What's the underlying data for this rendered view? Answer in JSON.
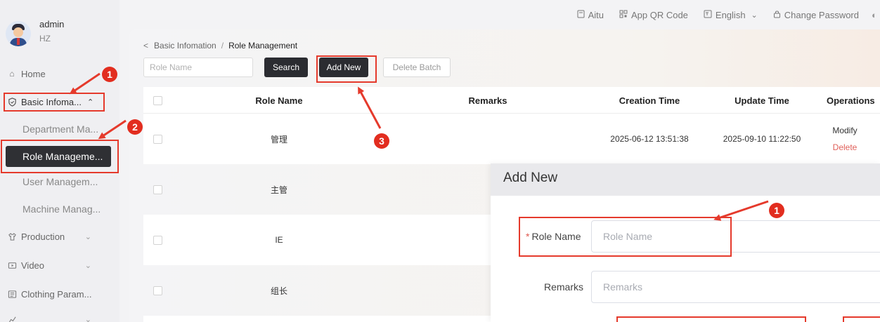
{
  "user": {
    "name": "admin",
    "org": "HZ"
  },
  "sidebar": {
    "home": "Home",
    "basic_info": "Basic Infoma...",
    "department": "Department Ma...",
    "role_management": "Role Manageme...",
    "user_management": "User Managem...",
    "machine_management": "Machine Manag...",
    "production": "Production",
    "video": "Video",
    "clothing": "Clothing Param..."
  },
  "topbar": {
    "aitu": "Aitu",
    "qr_code": "App QR Code",
    "language": "English",
    "change_password": "Change Password"
  },
  "breadcrumb": {
    "parent": "Basic Infomation",
    "current": "Role Management"
  },
  "toolbar": {
    "search_placeholder": "Role Name",
    "search_label": "Search",
    "add_new_label": "Add New",
    "delete_batch_label": "Delete Batch"
  },
  "table": {
    "headers": {
      "role_name": "Role Name",
      "remarks": "Remarks",
      "creation_time": "Creation Time",
      "update_time": "Update Time",
      "operations": "Operations"
    },
    "rows": [
      {
        "role_name": "管理",
        "remarks": "",
        "creation_time": "2025-06-12 13:51:38",
        "update_time": "2025-09-10 11:22:50",
        "modify": "Modify",
        "delete": "Delete"
      },
      {
        "role_name": "主管"
      },
      {
        "role_name": "IE"
      },
      {
        "role_name": "组长"
      }
    ]
  },
  "dialog": {
    "title": "Add New",
    "role_name_label": "Role Name",
    "role_name_placeholder": "Role Name",
    "remarks_label": "Remarks",
    "remarks_placeholder": "Remarks",
    "required_mark": "*"
  },
  "annotations": {
    "badge_1": "1",
    "badge_2": "2",
    "badge_3": "3",
    "badge_dialog_1": "1",
    "color": "#e53a2c"
  }
}
